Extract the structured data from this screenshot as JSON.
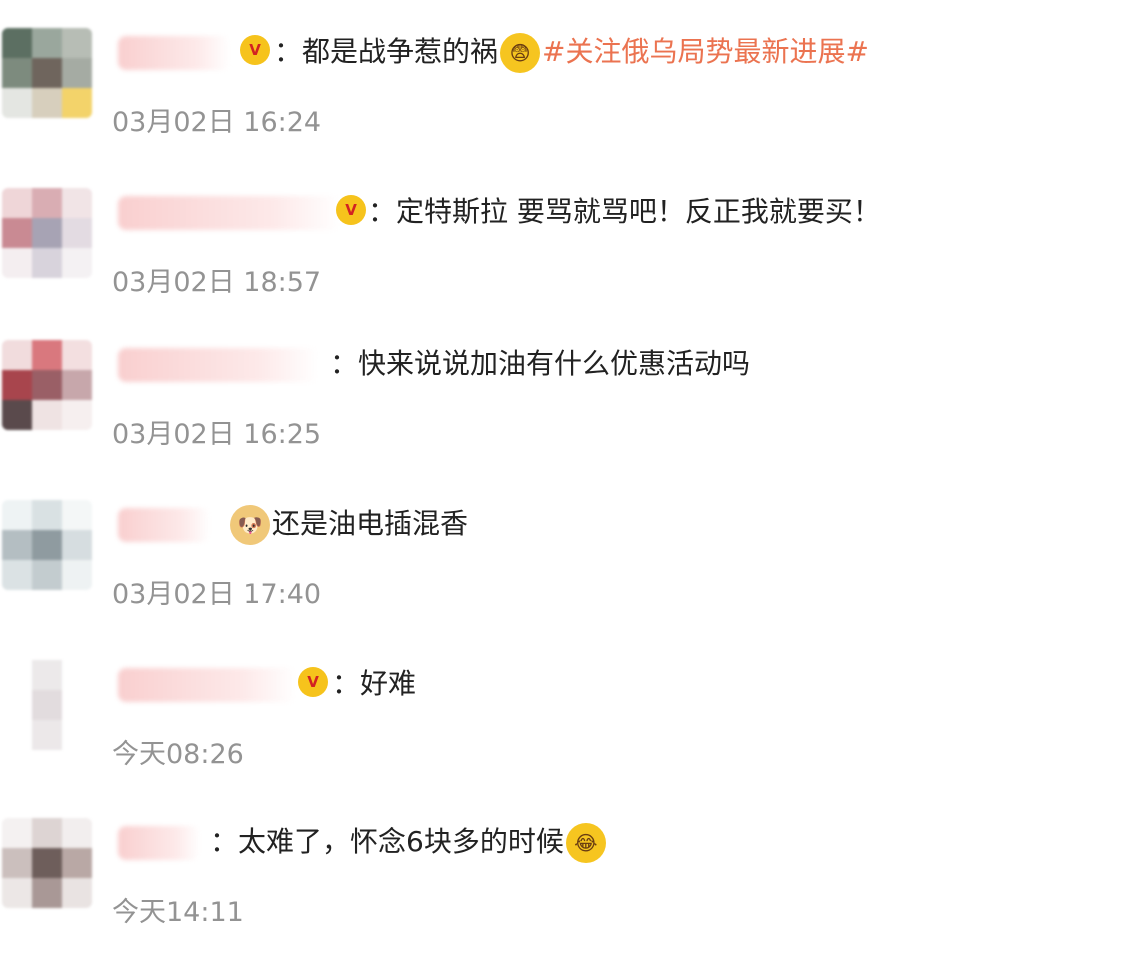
{
  "comments": [
    {
      "text": "：都是战争惹的祸",
      "emoji": "fearful-face-icon",
      "hashtag": "#关注俄乌局势最新进展#",
      "time": "03月02日 16:24"
    },
    {
      "text": "：定特斯拉 要骂就骂吧！反正我就要买！",
      "time": "03月02日 18:57"
    },
    {
      "text": "：快来说说加油有什么优惠活动吗",
      "time": "03月02日 16:25"
    },
    {
      "text": "还是油电插混香",
      "emoji": "doge-icon",
      "time": "03月02日 17:40"
    },
    {
      "text": "：好难",
      "time": "今天08:26"
    },
    {
      "text": "：太难了，怀念6块多的时候",
      "emoji": "crying-laughing-icon",
      "time": "今天14:11"
    }
  ],
  "colors": {
    "hashtag": "#eb7350",
    "timestamp": "#939393",
    "badge": "#f6c31c"
  }
}
